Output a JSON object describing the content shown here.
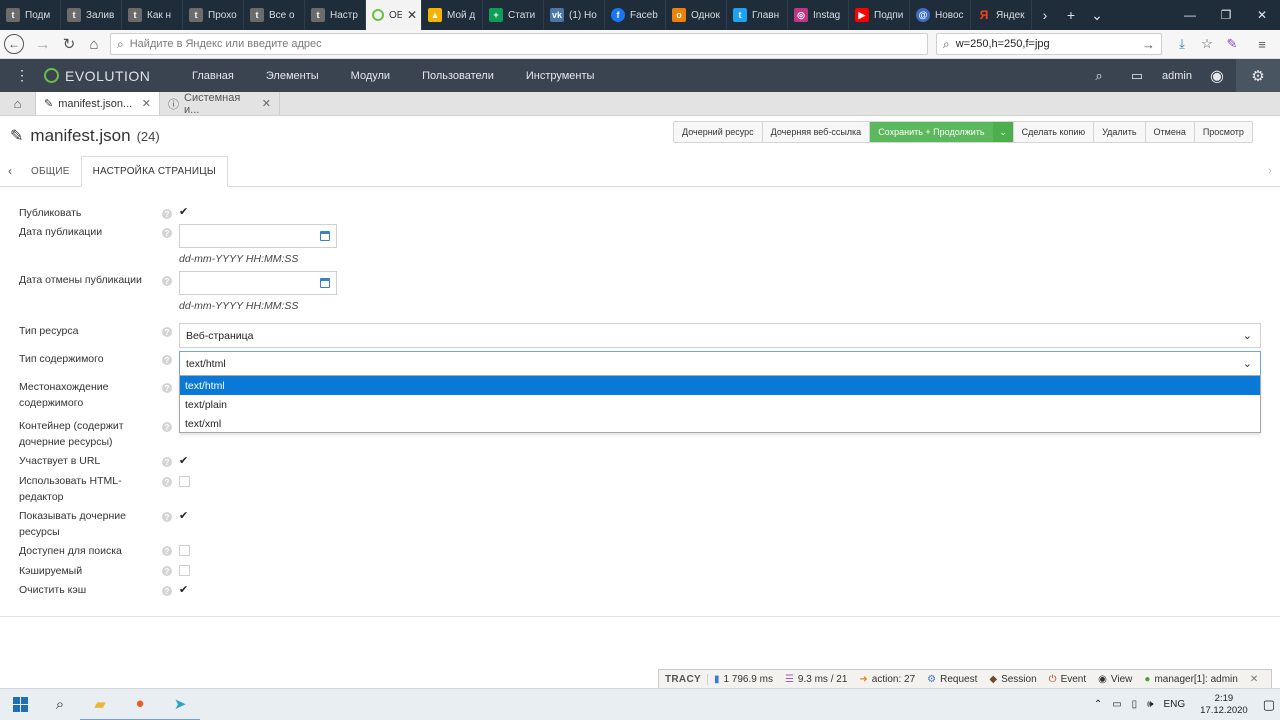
{
  "browser": {
    "tabs": [
      {
        "label": "Подм",
        "icon": "tumblr-icon",
        "color": "#6b6b6b"
      },
      {
        "label": "Залив",
        "icon": "tumblr-icon",
        "color": "#6b6b6b"
      },
      {
        "label": "Как н",
        "icon": "tumblr-icon",
        "color": "#6b6b6b"
      },
      {
        "label": "Прохо",
        "icon": "tumblr-icon",
        "color": "#6b6b6b"
      },
      {
        "label": "Все о",
        "icon": "tumblr-icon",
        "color": "#6b6b6b"
      },
      {
        "label": "Настр",
        "icon": "tumblr-icon",
        "color": "#6b6b6b"
      },
      {
        "label": "OE",
        "icon": "evolution-icon",
        "color": "#6cbe45",
        "active": true
      },
      {
        "label": "Мой д",
        "icon": "drive-icon",
        "color": "#f4b400"
      },
      {
        "label": "Стати",
        "icon": "sheets-icon",
        "color": "#0f9d58"
      },
      {
        "label": "(1) Но",
        "icon": "vk-icon",
        "color": "#4a76a8"
      },
      {
        "label": "Faceb",
        "icon": "facebook-icon",
        "color": "#1877f2"
      },
      {
        "label": "Однок",
        "icon": "ok-icon",
        "color": "#ee8208"
      },
      {
        "label": "Главн",
        "icon": "twitter-icon",
        "color": "#1da1f2"
      },
      {
        "label": "Instag",
        "icon": "instagram-icon",
        "color": "#c13584"
      },
      {
        "label": "Подпи",
        "icon": "youtube-icon",
        "color": "#ff0000"
      },
      {
        "label": "Новос",
        "icon": "mail-icon",
        "color": "#3b6fc4"
      },
      {
        "label": "Яндек",
        "icon": "yandex-icon",
        "color": "#fc3f1d"
      }
    ],
    "address_placeholder": "Найдите в Яндекс или введите адрес",
    "search_value": "w=250,h=250,f=jpg"
  },
  "cms": {
    "logo": "EVOLUTION",
    "menu": [
      "Главная",
      "Элементы",
      "Модули",
      "Пользователи",
      "Инструменты"
    ],
    "user": "admin",
    "doc_tabs": [
      "manifest.json...",
      "Системная и..."
    ]
  },
  "page": {
    "title": "manifest.json",
    "id": "(24)",
    "actions": [
      "Дочерний ресурс",
      "Дочерняя веб-ссылка",
      "Сохранить + Продолжить",
      "Сделать копию",
      "Удалить",
      "Отмена",
      "Просмотр"
    ],
    "save_color": "#5cb85c",
    "section_tabs": [
      "ОБЩИЕ",
      "НАСТРОЙКА СТРАНИЦЫ"
    ]
  },
  "form": {
    "publish": {
      "label": "Публиковать",
      "checked": true
    },
    "pub_date": {
      "label": "Дата публикации",
      "value": "",
      "hint": "dd-mm-YYYY HH:MM:SS"
    },
    "unpub_date": {
      "label": "Дата отмены публикации",
      "value": "",
      "hint": "dd-mm-YYYY HH:MM:SS"
    },
    "resource_type": {
      "label": "Тип ресурса",
      "value": "Веб-страница"
    },
    "content_type": {
      "label": "Тип содержимого",
      "value": "text/html",
      "options": [
        "text/html",
        "text/plain",
        "text/xml"
      ]
    },
    "location": {
      "label": "Местонахождение содержимого"
    },
    "container": {
      "label": "Контейнер (содержит дочерние ресурсы)"
    },
    "in_url": {
      "label": "Участвует в URL",
      "checked": true
    },
    "html_editor": {
      "label": "Использовать HTML-редактор",
      "checked": false
    },
    "show_children": {
      "label": "Показывать дочерние ресурсы",
      "checked": true
    },
    "searchable": {
      "label": "Доступен для поиска",
      "checked": false
    },
    "cacheable": {
      "label": "Кэшируемый",
      "checked": false
    },
    "clear_cache": {
      "label": "Очистить кэш",
      "checked": true
    }
  },
  "tracy": {
    "brand": "TRACY",
    "time": "1 796.9 ms",
    "db": "9.3 ms / 21",
    "action": "action: 27",
    "items": [
      "Request",
      "Session",
      "Event",
      "View"
    ],
    "manager": "manager[1]: admin"
  },
  "taskbar": {
    "lang": "ENG",
    "time": "2:19",
    "date": "17.12.2020"
  }
}
